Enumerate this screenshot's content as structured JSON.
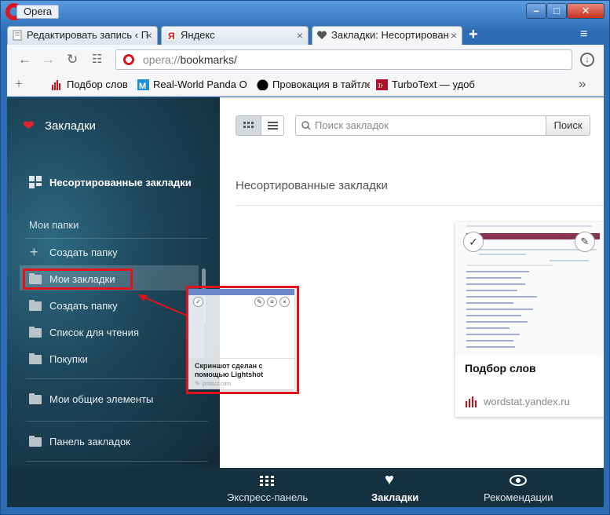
{
  "window": {
    "app_name": "Opera",
    "minimize": "–",
    "maximize": "□",
    "close": "✕"
  },
  "tabs": [
    {
      "title": "Редактировать запись ‹ П",
      "close": "×"
    },
    {
      "title": "Яндекс",
      "close": "×"
    },
    {
      "title": "Закладки: Несортирован",
      "close": "×"
    }
  ],
  "toolbar": {
    "back": "←",
    "forward": "→",
    "reload": "↻",
    "speed_dial": "☷",
    "url_scheme": "opera://",
    "url_rest": "bookmarks/",
    "download": "↓",
    "new_tab": "+",
    "tab_menu": "≡"
  },
  "bookmark_bar": {
    "add": "+",
    "items": [
      {
        "label": "Подбор слов"
      },
      {
        "label": "Real-World Panda Op"
      },
      {
        "label": "Провокация в тайтле"
      },
      {
        "label": "TurboText — удобна"
      }
    ],
    "more": "»"
  },
  "sidebar": {
    "title": "Закладки",
    "unsorted": "Несортированные закладки",
    "section": "Мои папки",
    "create_folder": "Создать папку",
    "folders": [
      {
        "label": "Мои закладки"
      },
      {
        "label": "Создать папку"
      },
      {
        "label": "Список для чтения"
      },
      {
        "label": "Покупки"
      },
      {
        "label": "Мои общие элементы"
      },
      {
        "label": "Панель закладок"
      }
    ]
  },
  "main": {
    "search_placeholder": "Поиск закладок",
    "search_button": "Поиск",
    "section_title": "Несортированные закладки",
    "card": {
      "title": "Подбор слов",
      "url": "wordstat.yandex.ru"
    }
  },
  "drag_ghost": {
    "title": "Скриншот сделан с помощью Lightshot",
    "url": "prntscr.com"
  },
  "bottom_nav": [
    {
      "label": "Экспресс-панель",
      "active": false
    },
    {
      "label": "Закладки",
      "active": true
    },
    {
      "label": "Рекомендации",
      "active": false
    }
  ],
  "colors": {
    "accent_red": "#e0141c",
    "sidebar_dark": "#1d4458",
    "bottom_nav": "#15303e"
  }
}
